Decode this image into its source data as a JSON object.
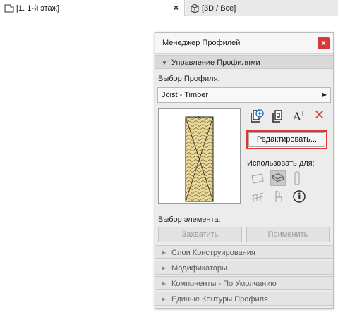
{
  "tabs": [
    {
      "label": "[1. 1-й этаж]",
      "icon": "floor-plan-icon",
      "close": "×"
    },
    {
      "label": "[3D / Все]",
      "icon": "3d-cube-icon"
    }
  ],
  "palette": {
    "title": "Менеджер Профилей",
    "close": "x",
    "section_manage": "Управление Профилями",
    "profile_select_label": "Выбор Профиля:",
    "profile_value": "Joist - Timber",
    "tools": [
      "new-profile-icon",
      "duplicate-profile-icon",
      "rename-profile-icon",
      "delete-profile-icon"
    ],
    "tool_labels": {
      "rename": "A",
      "rename_sub": "I",
      "delete": "✕"
    },
    "edit_button": "Редактировать...",
    "use_for_label": "Использовать для:",
    "use_for_icons": [
      "wall-icon",
      "beam-icon",
      "column-icon",
      "railing-icon",
      "chair-icon",
      "info-icon"
    ],
    "info_glyph": "i",
    "element_select_label": "Выбор элемента:",
    "capture_button": "Захватить",
    "apply_button": "Применить",
    "collapsed_sections": [
      "Слои Конструирования",
      "Модификаторы",
      "Компоненты - По Умолчанию",
      "Единые Контуры Профиля"
    ],
    "accent_color": "#e23232",
    "delete_color": "#e03a2a",
    "hatch_color": "#e8d89a"
  }
}
